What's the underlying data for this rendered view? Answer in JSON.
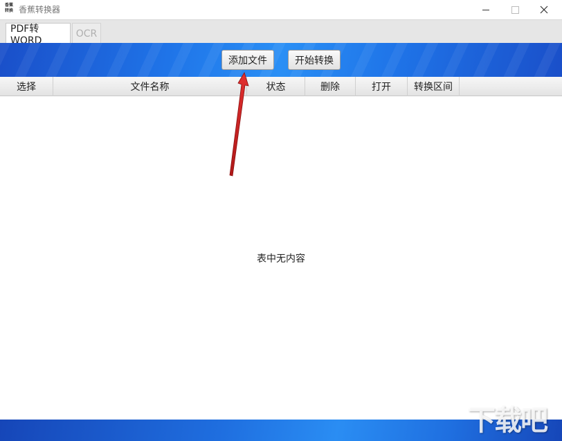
{
  "window": {
    "icon_text": "香蕉\n转换",
    "title": "香蕉转换器",
    "controls": {
      "minimize": "minimize",
      "maximize": "maximize",
      "close": "close"
    }
  },
  "tabs": [
    {
      "label": "PDF转WORD",
      "active": true
    },
    {
      "label": "OCR",
      "active": false
    }
  ],
  "toolbar": {
    "add_file": "添加文件",
    "start_convert": "开始转换"
  },
  "table": {
    "columns": [
      "选择",
      "文件名称",
      "状态",
      "删除",
      "打开",
      "转换区间"
    ],
    "rows": [],
    "empty_message": "表中无内容"
  },
  "annotation": {
    "arrow_color": "#cc2222"
  },
  "colors": {
    "accent": "#1f74e8",
    "arrow": "#cc2222"
  }
}
